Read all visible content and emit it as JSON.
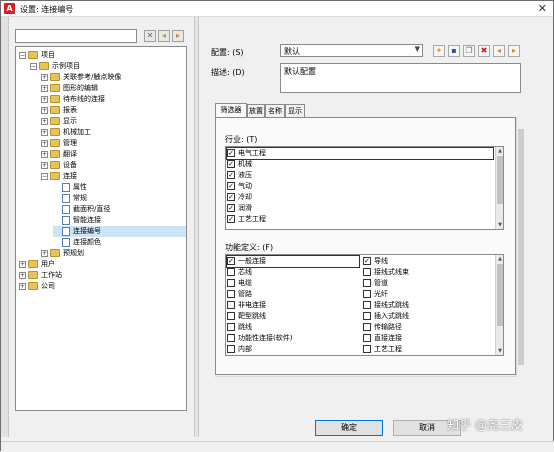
{
  "window": {
    "title": "设置: 连接编号",
    "app_icon_glyph": "A"
  },
  "search": {
    "value": ""
  },
  "tree": {
    "items": [
      {
        "label": "项目",
        "level": 0,
        "expander": "−",
        "icon": "folder"
      },
      {
        "label": "示例项目",
        "level": 1,
        "expander": "−",
        "icon": "folder"
      },
      {
        "label": "关联参考/触点映像",
        "level": 2,
        "expander": "+",
        "icon": "folder"
      },
      {
        "label": "图形的编辑",
        "level": 2,
        "expander": "+",
        "icon": "folder"
      },
      {
        "label": "待布线的连接",
        "level": 2,
        "expander": "+",
        "icon": "folder"
      },
      {
        "label": "报表",
        "level": 2,
        "expander": "+",
        "icon": "folder"
      },
      {
        "label": "显示",
        "level": 2,
        "expander": "+",
        "icon": "folder"
      },
      {
        "label": "机械加工",
        "level": 2,
        "expander": "+",
        "icon": "folder"
      },
      {
        "label": "管理",
        "level": 2,
        "expander": "+",
        "icon": "folder"
      },
      {
        "label": "翻译",
        "level": 2,
        "expander": "+",
        "icon": "folder"
      },
      {
        "label": "设备",
        "level": 2,
        "expander": "+",
        "icon": "folder"
      },
      {
        "label": "连接",
        "level": 2,
        "expander": "−",
        "icon": "folder"
      },
      {
        "label": "属性",
        "level": 3,
        "expander": "",
        "icon": "page"
      },
      {
        "label": "常规",
        "level": 3,
        "expander": "",
        "icon": "page"
      },
      {
        "label": "截面积/直径",
        "level": 3,
        "expander": "",
        "icon": "page"
      },
      {
        "label": "智能连接",
        "level": 3,
        "expander": "",
        "icon": "page"
      },
      {
        "label": "连接编号",
        "level": 3,
        "expander": "",
        "icon": "page",
        "selected": true
      },
      {
        "label": "连接颜色",
        "level": 3,
        "expander": "",
        "icon": "page"
      },
      {
        "label": "预规划",
        "level": 2,
        "expander": "+",
        "icon": "folder"
      },
      {
        "label": "用户",
        "level": 0,
        "expander": "+",
        "icon": "folder"
      },
      {
        "label": "工作站",
        "level": 0,
        "expander": "+",
        "icon": "folder"
      },
      {
        "label": "公司",
        "level": 0,
        "expander": "+",
        "icon": "folder"
      }
    ]
  },
  "config": {
    "label": "配置: (S)",
    "value": "默认",
    "desc_label": "描述: (D)",
    "desc_value": "默认配置"
  },
  "toolbar_icons": [
    "star-icon",
    "save-icon",
    "copy-icon",
    "delete-icon",
    "import-icon",
    "export-icon"
  ],
  "tabs": [
    "筛选器",
    "放置",
    "名称",
    "显示"
  ],
  "industry": {
    "label": "行业: (T)",
    "items": [
      {
        "label": "电气工程",
        "checked": true
      },
      {
        "label": "机械",
        "checked": true
      },
      {
        "label": "液压",
        "checked": true
      },
      {
        "label": "气动",
        "checked": true
      },
      {
        "label": "冷却",
        "checked": true
      },
      {
        "label": "润滑",
        "checked": true
      },
      {
        "label": "工艺工程",
        "checked": true
      }
    ]
  },
  "functions": {
    "label": "功能定义: (F)",
    "left": [
      {
        "label": "一般连接",
        "checked": true
      },
      {
        "label": "芯线",
        "checked": false
      },
      {
        "label": "电缆",
        "checked": false
      },
      {
        "label": "管路",
        "checked": false
      },
      {
        "label": "非电连接",
        "checked": false
      },
      {
        "label": "靶型跳线",
        "checked": false
      },
      {
        "label": "跳线",
        "checked": false
      },
      {
        "label": "功能性连接(软件)",
        "checked": false
      },
      {
        "label": "内部",
        "checked": false
      }
    ],
    "right": [
      {
        "label": "导线",
        "checked": true
      },
      {
        "label": "接线式线束",
        "checked": false
      },
      {
        "label": "管道",
        "checked": false
      },
      {
        "label": "光纤",
        "checked": false
      },
      {
        "label": "接线式跳线",
        "checked": false
      },
      {
        "label": "插入式跳线",
        "checked": false
      },
      {
        "label": "传输路径",
        "checked": false
      },
      {
        "label": "直接连接",
        "checked": false
      },
      {
        "label": "工艺工程",
        "checked": false
      }
    ]
  },
  "buttons": {
    "ok": "确定",
    "cancel": "取消"
  },
  "watermark": "知乎 @尧三皮"
}
